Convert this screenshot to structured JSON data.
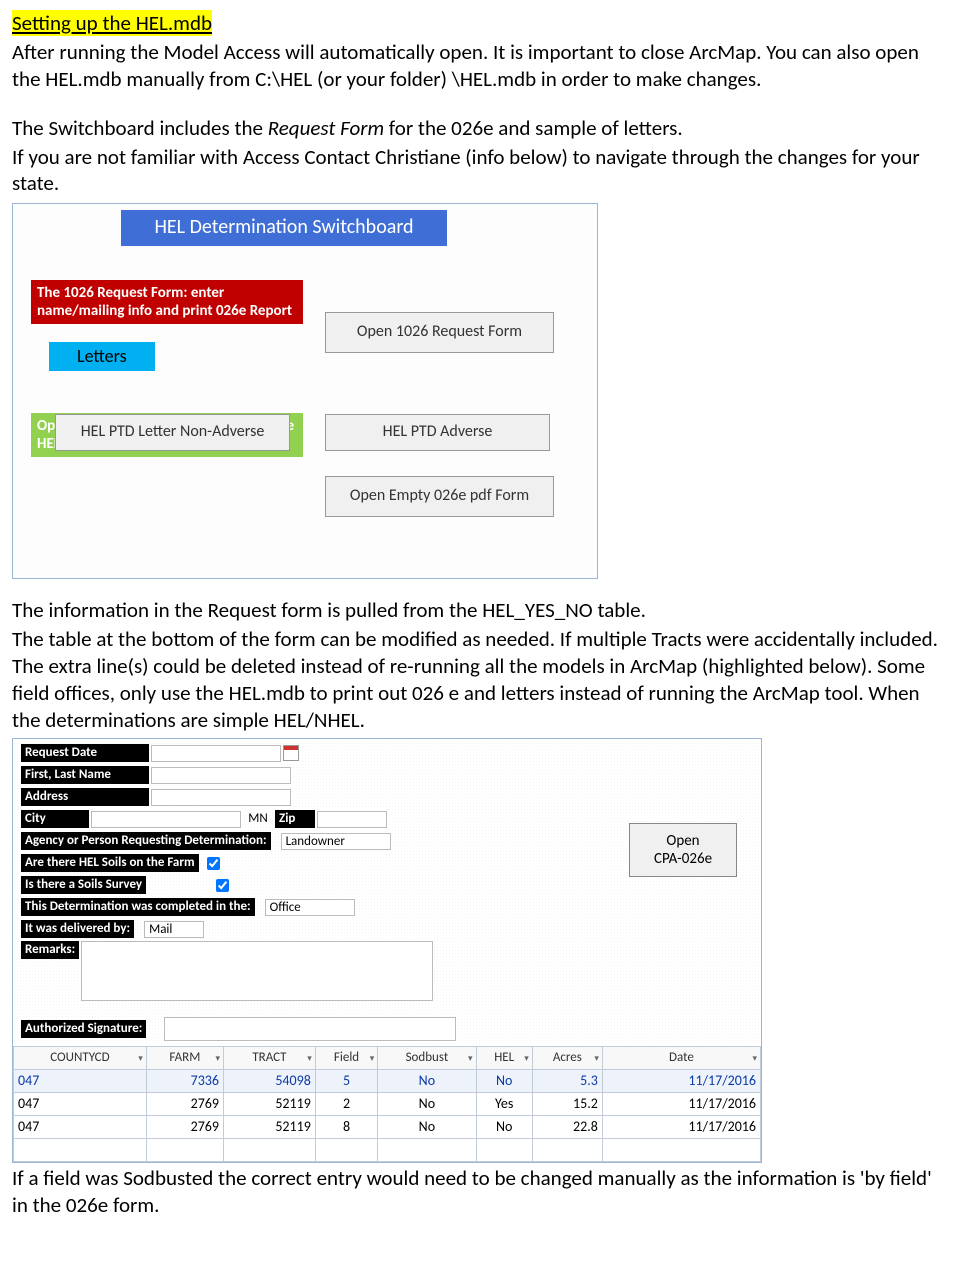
{
  "title": "Setting up the HEL.mdb",
  "para1": "After running the Model Access will automatically open. It is important to close ArcMap. You  can also open the HEL.mdb manually from C:\\HEL (or your folder) \\HEL.mdb in order to make changes.",
  "para2_pre": "The Switchboard includes the ",
  "para2_em": "Request Form",
  "para2_post": " for the 026e and sample of letters.",
  "para3": "If you are not familiar with Access Contact Christiane (info below) to navigate through the changes for your state.",
  "switchboard": {
    "title": "HEL Determination Switchboard",
    "red_note": "The 1026 Request Form: enter name/mailing info and print 026e Report",
    "btn_open_1026": "Open 1026 Request Form",
    "letters_label": "Letters",
    "btn_non_adverse": "HEL PTD Letter Non-Adverse",
    "btn_adverse": "HEL PTD Adverse",
    "green_note": "Open  a blank CPA-026e.pdf and enter the HEL summary  data manually",
    "btn_empty_026e": "Open Empty 026e pdf Form"
  },
  "para4": "The information in the Request form is pulled from the HEL_YES_NO table.",
  "para5": "The table at the bottom of the form can be modified as needed. If multiple Tracts were accidentally included. The extra line(s) could be deleted instead of re-running all the models in ArcMap (highlighted below). Some field offices, only use the HEL.mdb to print out 026 e and letters instead of running the ArcMap tool. When the determinations are simple HEL/NHEL.",
  "request_form": {
    "labels": {
      "request_date": "Request Date",
      "first_last": "First, Last Name",
      "address": "Address",
      "city": "City",
      "zip": "Zip",
      "agency": "Agency or Person Requesting Determination:",
      "hel_soils": "Are there HEL Soils on the Farm",
      "soils_survey": "Is there a Soils Survey",
      "completed_in": "This Determination was completed in the:",
      "delivered_by": "It was delivered by:",
      "remarks": "Remarks:",
      "auth_sig": "Authorized Signature:"
    },
    "values": {
      "state": "MN",
      "agency_val": "Landowner",
      "completed_val": "Office",
      "delivered_val": "Mail"
    },
    "open_cpa_btn_l1": "Open",
    "open_cpa_btn_l2": "CPA-026e",
    "table": {
      "headers": [
        "COUNTYCD",
        "FARM",
        "TRACT",
        "Field",
        "Sodbust",
        "HEL",
        "Acres",
        "Date"
      ],
      "rows": [
        {
          "county": "047",
          "farm": "7336",
          "tract": "54098",
          "field": "5",
          "sodbust": "No",
          "hel": "No",
          "acres": "5.3",
          "date": "11/17/2016",
          "hl": true
        },
        {
          "county": "047",
          "farm": "2769",
          "tract": "52119",
          "field": "2",
          "sodbust": "No",
          "hel": "Yes",
          "acres": "15.2",
          "date": "11/17/2016",
          "hl": false
        },
        {
          "county": "047",
          "farm": "2769",
          "tract": "52119",
          "field": "8",
          "sodbust": "No",
          "hel": "No",
          "acres": "22.8",
          "date": "11/17/2016",
          "hl": false
        }
      ]
    }
  },
  "para6": "If a field was Sodbusted the correct entry would need to be changed manually as the information is 'by field' in the 026e form."
}
